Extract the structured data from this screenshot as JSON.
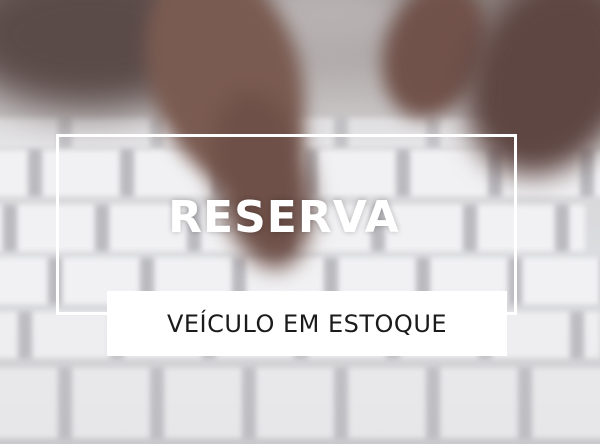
{
  "overlay": {
    "title": "RESERVA",
    "subtitle": "VEÍCULO EM ESTOQUE"
  },
  "colors": {
    "frame": "#ffffff",
    "banner_bg": "#ffffff",
    "title_text": "#ffffff",
    "subtitle_text": "#1b1b1b"
  }
}
